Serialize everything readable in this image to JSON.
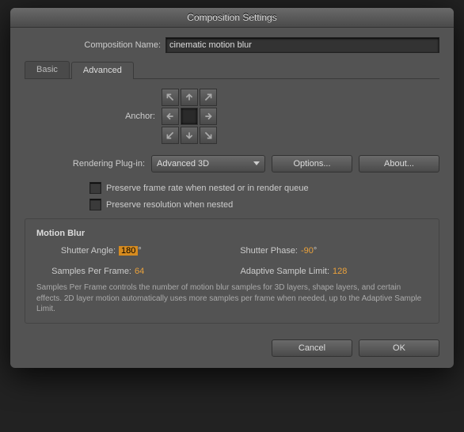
{
  "window": {
    "title": "Composition Settings"
  },
  "comp_name": {
    "label": "Composition Name:",
    "value": "cinematic motion blur"
  },
  "tabs": {
    "basic": "Basic",
    "advanced": "Advanced",
    "active": "advanced"
  },
  "anchor": {
    "label": "Anchor:"
  },
  "render": {
    "label": "Rendering Plug-in:",
    "selected": "Advanced 3D",
    "options_btn": "Options...",
    "about_btn": "About..."
  },
  "checkboxes": {
    "preserve_fps": "Preserve frame rate when nested or in render queue",
    "preserve_res": "Preserve resolution when nested"
  },
  "motion_blur": {
    "title": "Motion Blur",
    "shutter_angle_label": "Shutter Angle:",
    "shutter_angle_value": "180",
    "shutter_angle_degree": "°",
    "shutter_phase_label": "Shutter Phase:",
    "shutter_phase_value": "-90",
    "shutter_phase_degree": "°",
    "samples_label": "Samples Per Frame:",
    "samples_value": "64",
    "adaptive_label": "Adaptive Sample Limit:",
    "adaptive_value": "128",
    "help": "Samples Per Frame controls the number of motion blur samples for 3D layers, shape layers, and certain effects. 2D layer motion automatically uses more samples per frame when needed, up to the Adaptive Sample Limit."
  },
  "footer": {
    "cancel": "Cancel",
    "ok": "OK"
  }
}
